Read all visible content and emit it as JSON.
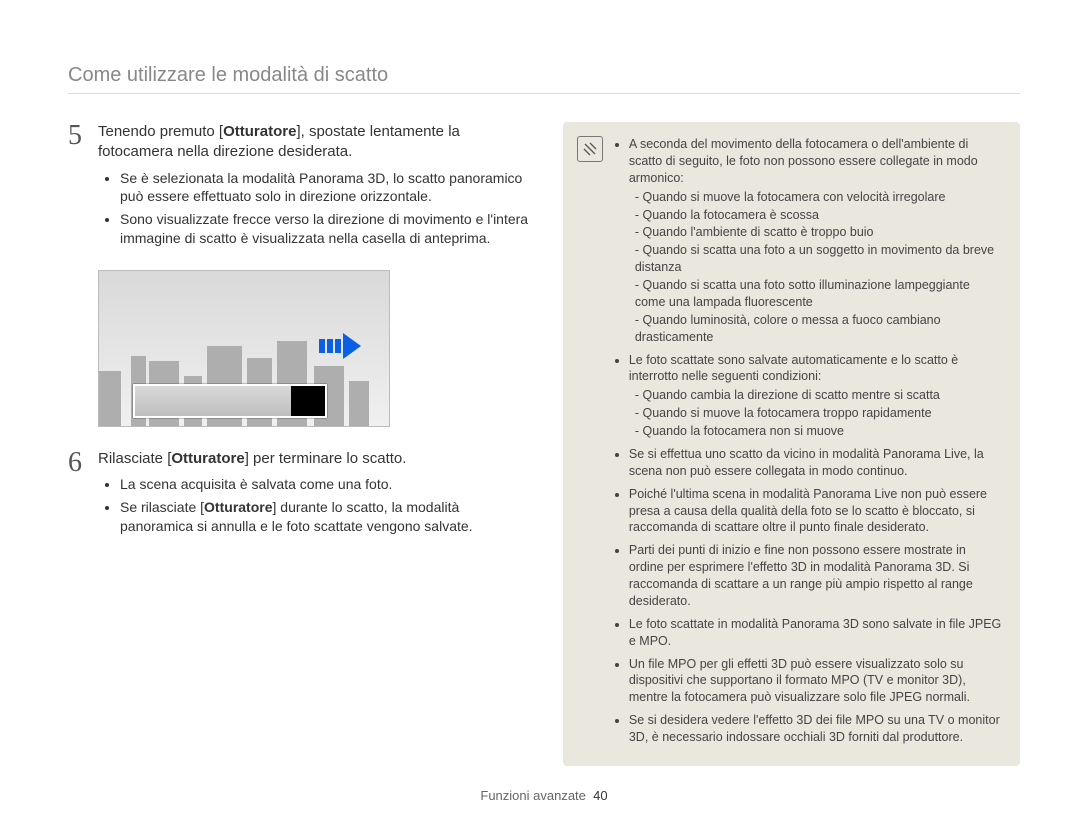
{
  "header": "Come utilizzare le modalità di scatto",
  "steps": [
    {
      "num": "5",
      "lead_pre": "Tenendo premuto [",
      "lead_bold": "Otturatore",
      "lead_post": "], spostate lentamente la fotocamera nella direzione desiderata.",
      "bullets": [
        "Se è selezionata la modalità Panorama 3D, lo scatto panoramico può essere effettuato solo in direzione orizzontale.",
        "Sono visualizzate frecce verso la direzione di movimento e l'intera immagine di scatto è visualizzata nella casella di anteprima."
      ]
    },
    {
      "num": "6",
      "lead_pre": "Rilasciate [",
      "lead_bold": "Otturatore",
      "lead_post": "] per terminare lo scatto.",
      "bullets": [
        "La scena acquisita è salvata come una foto.",
        "__rich__"
      ],
      "rich_bullet": {
        "pre": "Se rilasciate [",
        "bold": "Otturatore",
        "post": "] durante lo scatto, la modalità panoramica si annulla e le foto scattate vengono salvate."
      }
    }
  ],
  "notes": [
    {
      "text": "A seconda del movimento della fotocamera o dell'ambiente di scatto di seguito, le foto non possono essere collegate in modo armonico:",
      "dashes": [
        "Quando si muove la fotocamera con velocità irregolare",
        "Quando la fotocamera è scossa",
        "Quando l'ambiente di scatto è troppo buio",
        "Quando si scatta una foto a un soggetto in movimento da breve distanza",
        "Quando si scatta una foto sotto illuminazione lampeggiante come una lampada fluorescente",
        "Quando luminosità, colore o messa a fuoco cambiano drasticamente"
      ]
    },
    {
      "text": "Le foto scattate sono salvate automaticamente e lo scatto è interrotto nelle seguenti condizioni:",
      "dashes": [
        "Quando cambia la direzione di scatto mentre si scatta",
        "Quando si muove la fotocamera troppo rapidamente",
        "Quando la fotocamera non si muove"
      ]
    },
    {
      "text": "Se si effettua uno scatto da vicino in modalità Panorama Live, la scena non può essere collegata in modo continuo."
    },
    {
      "text": "Poiché l'ultima scena in modalità Panorama Live non può essere presa a causa della qualità della foto se lo scatto è bloccato, si raccomanda di scattare oltre il punto finale desiderato."
    },
    {
      "text": "Parti dei punti di inizio e fine non possono essere mostrate in ordine per esprimere l'effetto 3D in modalità Panorama 3D. Si raccomanda di scattare a un range più ampio rispetto al range desiderato."
    },
    {
      "text": "Le foto scattate in modalità Panorama 3D sono salvate in file JPEG e MPO."
    },
    {
      "text": "Un file MPO per gli effetti 3D può essere visualizzato solo su dispositivi che supportano il formato MPO (TV e monitor 3D), mentre la fotocamera può visualizzare solo file JPEG normali."
    },
    {
      "text": "Se si desidera vedere l'effetto 3D dei file MPO su una TV o monitor 3D, è necessario indossare occhiali 3D forniti dal produttore."
    }
  ],
  "footer": {
    "section": "Funzioni avanzate",
    "page": "40"
  }
}
